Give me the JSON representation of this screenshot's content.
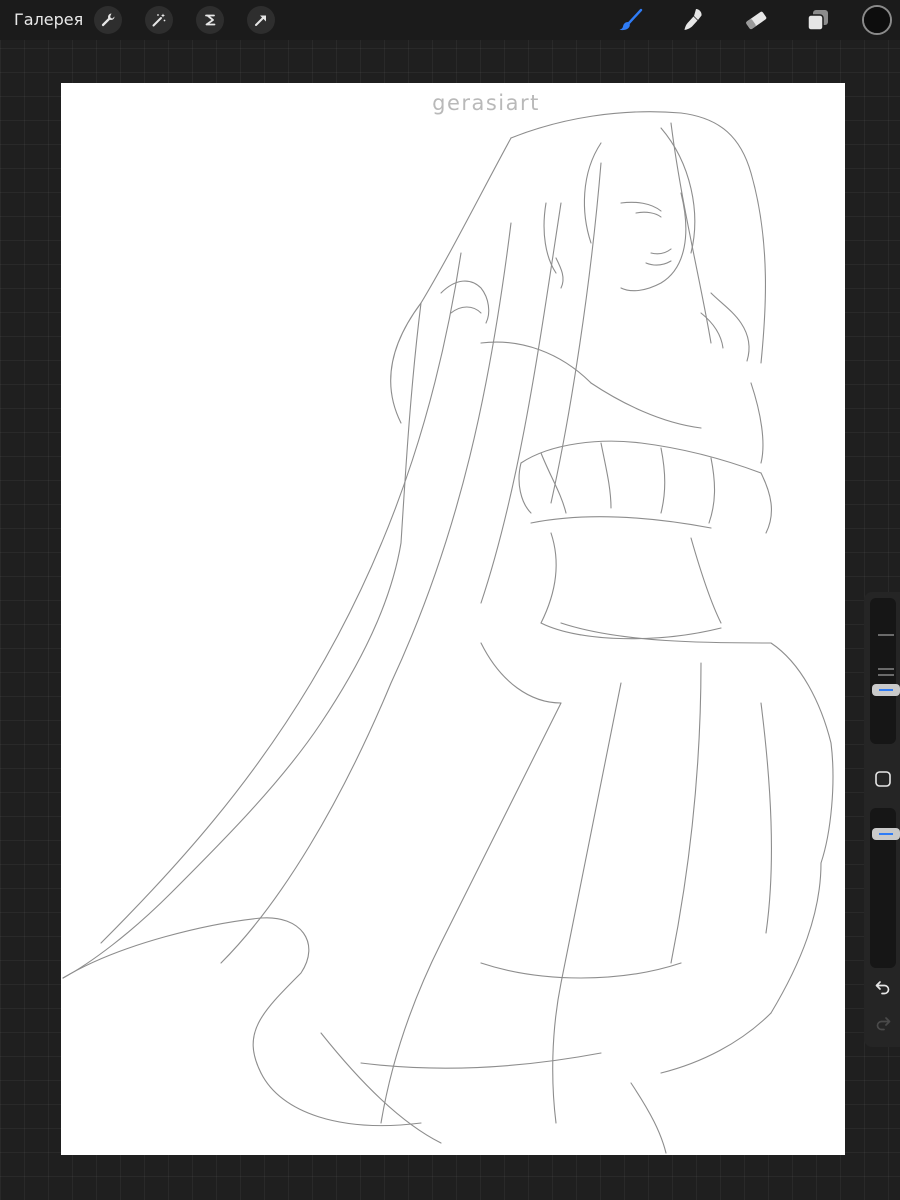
{
  "topbar": {
    "gallery_label": "Галерея",
    "tools_left": [
      {
        "icon": "wrench-icon",
        "name": "actions"
      },
      {
        "icon": "magic-wand-icon",
        "name": "adjustments"
      },
      {
        "icon": "selection-icon",
        "name": "selection"
      },
      {
        "icon": "transform-arrow-icon",
        "name": "transform"
      }
    ],
    "tools_right": [
      {
        "icon": "brush-icon",
        "name": "paint",
        "active": true
      },
      {
        "icon": "smudge-icon",
        "name": "smudge",
        "active": false
      },
      {
        "icon": "eraser-icon",
        "name": "eraser",
        "active": false
      },
      {
        "icon": "layers-icon",
        "name": "layers",
        "active": false
      }
    ],
    "current_color": "#0d0d0d"
  },
  "canvas": {
    "watermark": "gerasiart",
    "background": "#ffffff",
    "artwork": "pencil sketch"
  },
  "sidebar": {
    "brush_size_icon": "brush-size-slider",
    "modify_button_icon": "square-modify-icon",
    "opacity_icon": "opacity-slider",
    "undo_icon": "undo-icon",
    "redo_icon": "redo-icon"
  },
  "colors": {
    "accent": "#2f7cf6",
    "ui_dark": "#1f1f1f",
    "toolbar": "#1b1b1b"
  }
}
